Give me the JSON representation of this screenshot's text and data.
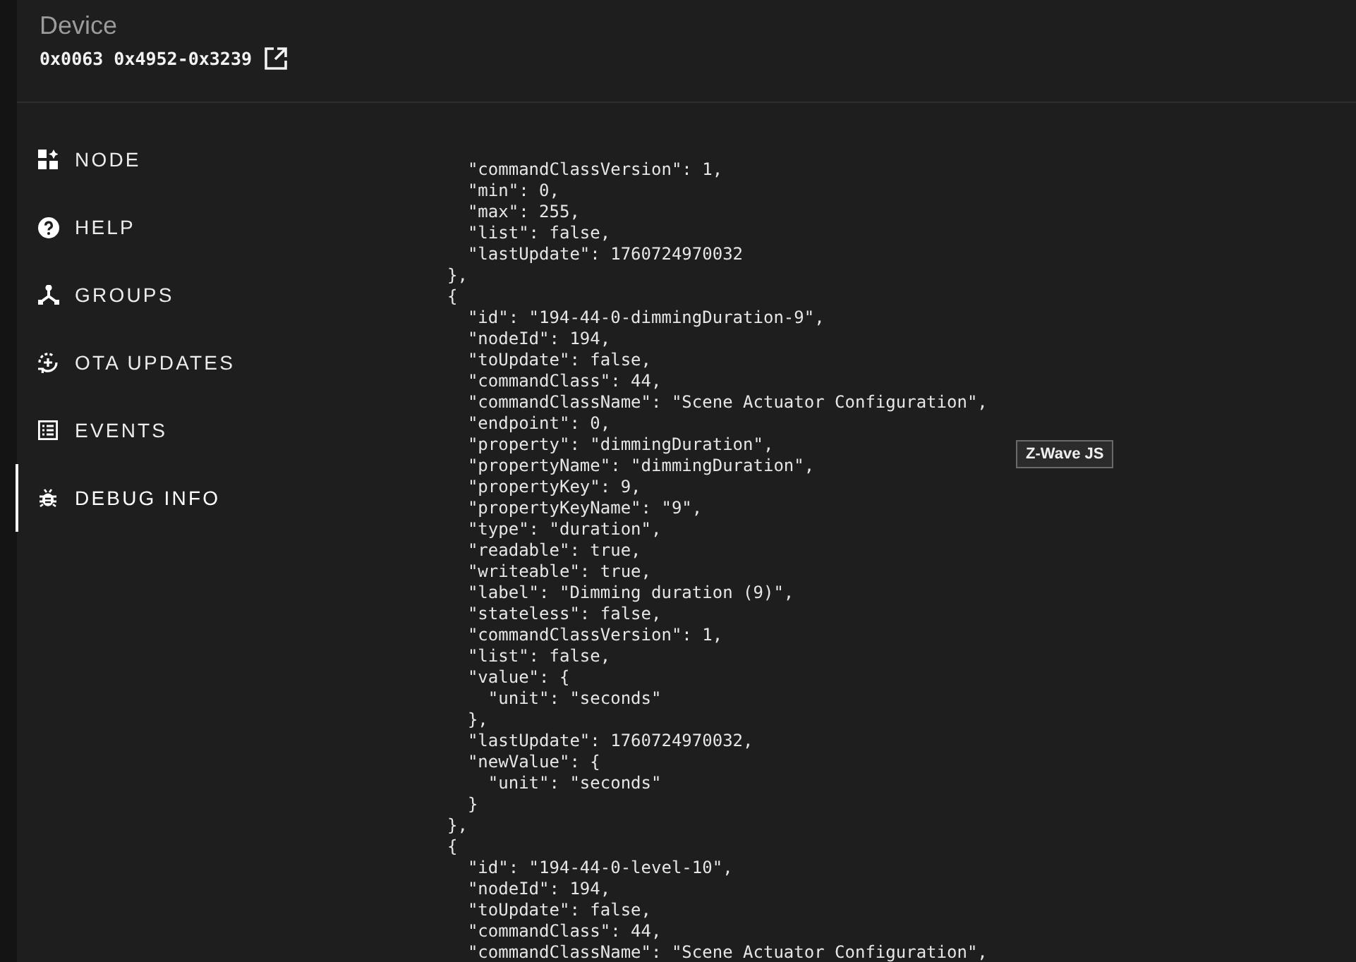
{
  "header": {
    "title": "Device",
    "device_id": "0x0063 0x4952-0x3239"
  },
  "nav": [
    {
      "label": "NODE",
      "kind": "node",
      "selected": false
    },
    {
      "label": "HELP",
      "kind": "help",
      "selected": false
    },
    {
      "label": "GROUPS",
      "kind": "groups",
      "selected": false
    },
    {
      "label": "OTA UPDATES",
      "kind": "ota",
      "selected": false
    },
    {
      "label": "EVENTS",
      "kind": "events",
      "selected": false
    },
    {
      "label": "DEBUG INFO",
      "kind": "debug",
      "selected": true
    }
  ],
  "debug_lines": [
    "  \"commandClassVersion\": 1,",
    "  \"min\": 0,",
    "  \"max\": 255,",
    "  \"list\": false,",
    "  \"lastUpdate\": 1760724970032",
    "},",
    "{",
    "  \"id\": \"194-44-0-dimmingDuration-9\",",
    "  \"nodeId\": 194,",
    "  \"toUpdate\": false,",
    "  \"commandClass\": 44,",
    "  \"commandClassName\": \"Scene Actuator Configuration\",",
    "  \"endpoint\": 0,",
    "  \"property\": \"dimmingDuration\",",
    "  \"propertyName\": \"dimmingDuration\",",
    "  \"propertyKey\": 9,",
    "  \"propertyKeyName\": \"9\",",
    "  \"type\": \"duration\",",
    "  \"readable\": true,",
    "  \"writeable\": true,",
    "  \"label\": \"Dimming duration (9)\",",
    "  \"stateless\": false,",
    "  \"commandClassVersion\": 1,",
    "  \"list\": false,",
    "  \"value\": {",
    "    \"unit\": \"seconds\"",
    "  },",
    "  \"lastUpdate\": 1760724970032,",
    "  \"newValue\": {",
    "    \"unit\": \"seconds\"",
    "  }",
    "},",
    "{",
    "  \"id\": \"194-44-0-level-10\",",
    "  \"nodeId\": 194,",
    "  \"toUpdate\": false,",
    "  \"commandClass\": 44,",
    "  \"commandClassName\": \"Scene Actuator Configuration\","
  ],
  "tooltip": "Z-Wave JS"
}
